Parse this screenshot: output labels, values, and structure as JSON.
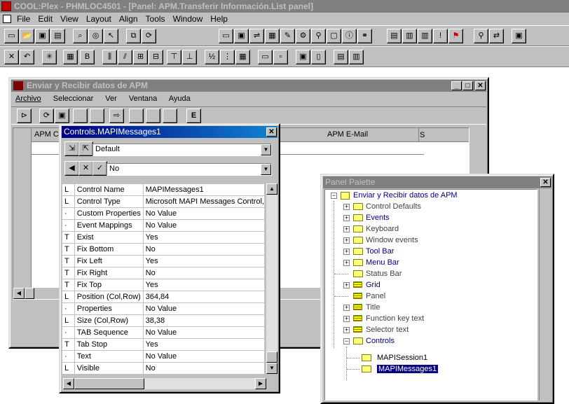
{
  "app": {
    "title": "COOL:Plex - PHMLOC4501 - [Panel: APM.Transferir Información.List panel]"
  },
  "menu": [
    "File",
    "Edit",
    "View",
    "Layout",
    "Align",
    "Tools",
    "Window",
    "Help"
  ],
  "child": {
    "title": "Enviar y Recibir datos de  APM",
    "menu": [
      "Archivo",
      "Seleccionar",
      "Ver",
      "Ventana",
      "Ayuda"
    ],
    "toolbar_e": "E",
    "grid_headers": [
      "APM C",
      "APM E-Mail",
      "S"
    ]
  },
  "props": {
    "title": "Controls.MAPIMessages1",
    "combo1": "Default",
    "combo2": "No",
    "rows": [
      [
        "L",
        "Control Name",
        "MAPIMessages1"
      ],
      [
        "L",
        "Control Type",
        "Microsoft MAPI Messages Control,"
      ],
      [
        "·",
        "Custom Properties",
        "No Value"
      ],
      [
        "·",
        "Event Mappings",
        "No Value"
      ],
      [
        "T",
        "Exist",
        "Yes"
      ],
      [
        "T",
        "Fix Bottom",
        "No"
      ],
      [
        "T",
        "Fix Left",
        "Yes"
      ],
      [
        "T",
        "Fix Right",
        "No"
      ],
      [
        "T",
        "Fix Top",
        "Yes"
      ],
      [
        "L",
        "Position (Col,Row)",
        "364,84"
      ],
      [
        "·",
        "Properties",
        "No Value"
      ],
      [
        "L",
        "Size (Col,Row)",
        "38,38"
      ],
      [
        "·",
        "TAB Sequence",
        "No Value"
      ],
      [
        "T",
        "Tab Stop",
        "Yes"
      ],
      [
        "·",
        "Text",
        "No Value"
      ],
      [
        "L",
        "Visible",
        "No"
      ]
    ]
  },
  "palette": {
    "title": "Panel Palette",
    "root": "Enviar y Recibir datos de  APM",
    "items": [
      "Control Defaults",
      "Events",
      "Keyboard",
      "Window events",
      "Tool Bar",
      "Menu Bar",
      "Status Bar",
      "Grid",
      "Panel",
      "Title",
      "Function key text",
      "Selector text",
      "Controls"
    ],
    "children": [
      "MAPISession1",
      "MAPIMessages1"
    ]
  }
}
